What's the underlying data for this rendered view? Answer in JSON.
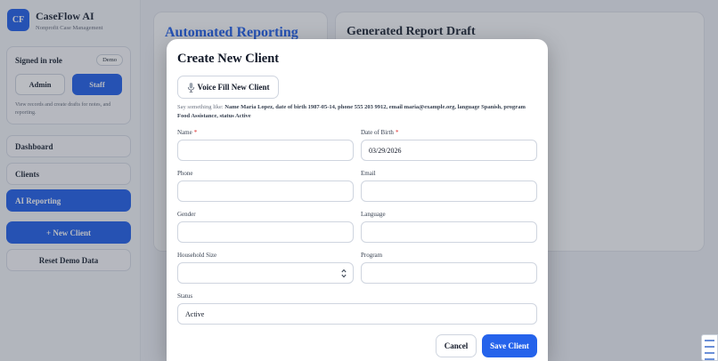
{
  "sidebar": {
    "logo_initials": "CF",
    "app_name": "CaseFlow AI",
    "app_subtitle": "Nonprofit Case Management",
    "role_card": {
      "title": "Signed in role",
      "badge": "Demo",
      "admin_label": "Admin",
      "staff_label": "Staff",
      "selected": "Staff",
      "description": "View records and create drafts for notes, and reporting."
    },
    "nav": [
      {
        "label": "Dashboard",
        "active": false
      },
      {
        "label": "Clients",
        "active": false
      },
      {
        "label": "AI Reporting",
        "active": true
      }
    ],
    "new_client_label": "+ New Client",
    "reset_label": "Reset Demo Data"
  },
  "main": {
    "left_panel_title": "Automated Reporting",
    "right_panel_title": "Generated Report Draft"
  },
  "modal": {
    "title": "Create New Client",
    "voice_button_label": "Voice Fill New Client",
    "hint_prefix": "Say something like: ",
    "hint_example": "Name Maria Lopez, date of birth 1987-05-14, phone 555 203 9912, email maria@example.org, language Spanish, program Food Assistance, status Active",
    "fields": {
      "name": {
        "label": "Name",
        "required": true,
        "value": ""
      },
      "dob": {
        "label": "Date of Birth",
        "required": true,
        "value": "03/29/2026"
      },
      "phone": {
        "label": "Phone",
        "value": ""
      },
      "email": {
        "label": "Email",
        "value": ""
      },
      "gender": {
        "label": "Gender",
        "value": ""
      },
      "language": {
        "label": "Language",
        "value": ""
      },
      "household_size": {
        "label": "Household Size",
        "value": ""
      },
      "program": {
        "label": "Program",
        "value": ""
      },
      "status": {
        "label": "Status",
        "value": "Active"
      }
    },
    "required_marker": "*",
    "cancel_label": "Cancel",
    "save_label": "Save Client"
  },
  "colors": {
    "accent": "#2563eb",
    "required": "#dc2626"
  }
}
